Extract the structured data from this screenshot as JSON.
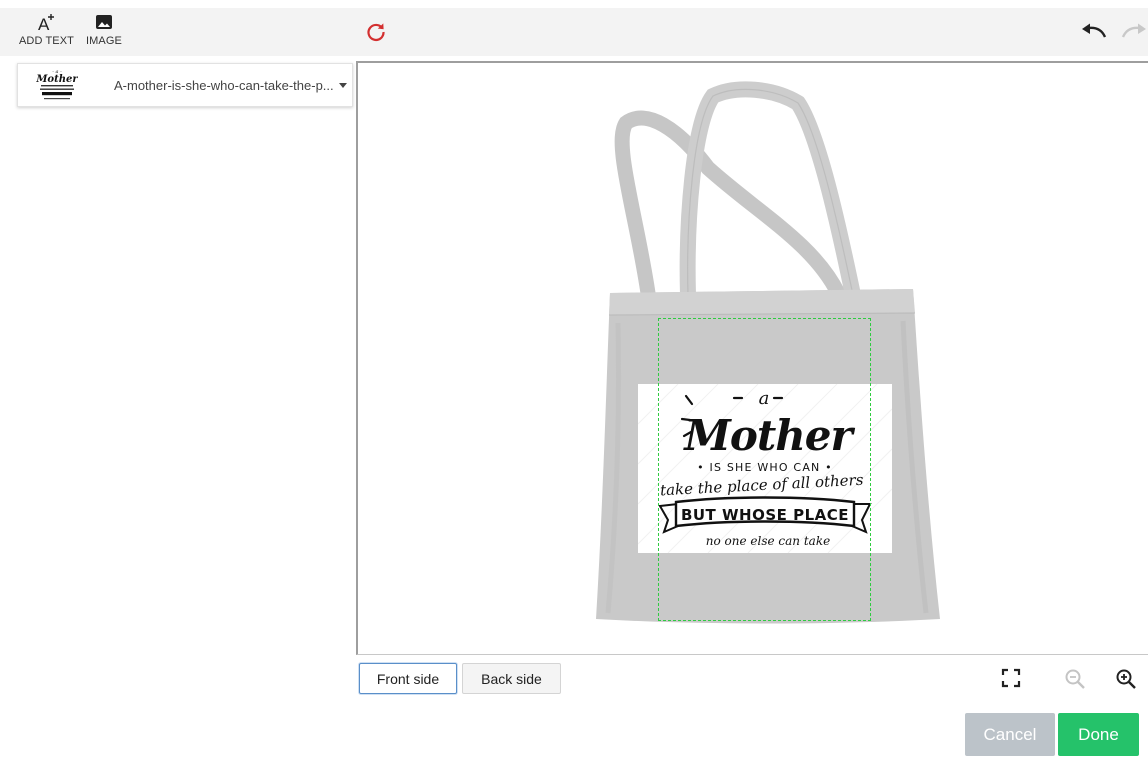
{
  "toolbar": {
    "add_text_label": "ADD TEXT",
    "image_label": "IMAGE"
  },
  "layers": [
    {
      "name": "A-mother-is-she-who-can-take-the-p...",
      "thumb_word": "Mother"
    }
  ],
  "design": {
    "line1": "a",
    "line2": "Mother",
    "line3": "• IS SHE WHO CAN •",
    "line4": "take the place of all others",
    "line5": "BUT WHOSE PLACE",
    "line6": "no one else can take"
  },
  "sides": {
    "front": "Front side",
    "back": "Back side"
  },
  "actions": {
    "cancel": "Cancel",
    "done": "Done"
  },
  "colors": {
    "print_area": "#2ecc40",
    "done": "#25c26a",
    "cancel": "#bcc3c9",
    "reset_icon": "#d32f2f",
    "bag": "#c9c9c9"
  },
  "icons": [
    "add-text-icon",
    "image-icon",
    "reset-icon",
    "undo-icon",
    "redo-icon",
    "fullscreen-icon",
    "zoom-out-icon",
    "zoom-in-icon"
  ]
}
